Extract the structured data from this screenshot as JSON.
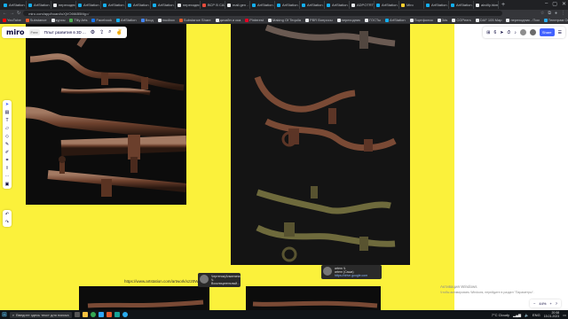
{
  "browser": {
    "tabs": [
      {
        "label": "ArtStation - Mari",
        "color": "#13aff0"
      },
      {
        "label": "ArtStation - Old",
        "color": "#13aff0"
      },
      {
        "label": "переходник",
        "color": "#e8eaed"
      },
      {
        "label": "ArtStation - Pipe",
        "color": "#13aff0"
      },
      {
        "label": "ArtStation - Old",
        "color": "#13aff0"
      },
      {
        "label": "ArtStation - Mari",
        "color": "#13aff0"
      },
      {
        "label": "ArtStation - Old",
        "color": "#13aff0"
      },
      {
        "label": "переходник - Пои",
        "color": "#e8eaed"
      },
      {
        "label": "ВСР В САРАТО",
        "color": "#e74c3c"
      },
      {
        "label": "mail.gen - Поис",
        "color": "#e8eaed"
      },
      {
        "label": "ArtStation - Sec",
        "color": "#13aff0"
      },
      {
        "label": "ArtStation - Virtu",
        "color": "#13aff0"
      },
      {
        "label": "ArtStation - Sec",
        "color": "#13aff0"
      },
      {
        "label": "ArtStation - Sec",
        "color": "#13aff0"
      },
      {
        "label": "ADPOTRT 6880",
        "color": "#e8eaed"
      },
      {
        "label": "ArtStation - Rus",
        "color": "#13aff0"
      },
      {
        "label": "Miro",
        "color": "#ffd02f"
      },
      {
        "label": "ArtStation - Sec",
        "color": "#13aff0"
      },
      {
        "label": "ArtStation - Gen",
        "color": "#13aff0"
      },
      {
        "label": "akvilly.hkm-mo",
        "color": "#e8eaed"
      }
    ],
    "address": "miro.com/app/board/uXjVO6fAB5Mg=/",
    "bookmarks": [
      {
        "label": "YouTube",
        "color": "#ff0000"
      },
      {
        "label": "Substance",
        "color": "#e55a2b"
      },
      {
        "label": "курсы",
        "color": "#e8eaed"
      },
      {
        "label": "Tilly Arts",
        "color": "#4caf50"
      },
      {
        "label": "Facebook",
        "color": "#1877f2"
      },
      {
        "label": "ArtStation",
        "color": "#13aff0"
      },
      {
        "label": "Вход",
        "color": "#4285f4"
      },
      {
        "label": "mudbox",
        "color": "#e8eaed"
      },
      {
        "label": "Substance Share",
        "color": "#e55a2b"
      },
      {
        "label": "дизайн и ска",
        "color": "#e8eaed"
      },
      {
        "label": "Pinterest",
        "color": "#e60023"
      },
      {
        "label": "Making Of Tequila",
        "color": "#e8eaed"
      },
      {
        "label": "PBR Вопросы",
        "color": "#e8eaed"
      },
      {
        "label": "переходник",
        "color": "#e8eaed"
      },
      {
        "label": "ГОСТы",
        "color": "#e8eaed"
      },
      {
        "label": "ArtStation",
        "color": "#13aff0"
      },
      {
        "label": "Портфолио",
        "color": "#e8eaed"
      },
      {
        "label": "3ds",
        "color": "#e8eaed"
      },
      {
        "label": "CGPeers",
        "color": "#e8eaed"
      },
      {
        "label": "DAF 105 Map",
        "color": "#e8eaed"
      },
      {
        "label": "переходник - Пои",
        "color": "#e8eaed"
      },
      {
        "label": "Телеграм Онлайн",
        "color": "#2aabee"
      }
    ]
  },
  "miro": {
    "logo": "miro",
    "plan": "Free",
    "board_title": "Плыт развития в 3D ...",
    "rightbar": {
      "count": "6",
      "share_label": "Share",
      "zoom": "44%"
    },
    "toolbar": [
      "cursor",
      "template",
      "text",
      "sticky",
      "shape",
      "pen",
      "comment",
      "frame",
      "upload",
      "more",
      "apps"
    ],
    "link_text": "https://www.artstation.com/artwork/xz20WNz",
    "comments": [
      {
        "name": "Чертенок(Анжелина Ч.",
        "text": "Восклицательный...",
        "link": ""
      },
      {
        "name": "artem Ч.",
        "text": "artem (Саша)",
        "link": "https://drive.google.com"
      }
    ]
  },
  "windows": {
    "activation_title": "Активация Windows",
    "activation_sub": "Чтобы активировать Windows, перейдите в раздел \"Параметры\".",
    "search_placeholder": "Введите здесь текст для поиска",
    "weather": "7°C Cloudy",
    "lang": "ENG",
    "time": "20:58",
    "date": "15.01.2023"
  },
  "colors": {
    "canvas_bg": "#fbf13b",
    "art_bg": "#0c0c0c",
    "miro_accent": "#4262ff"
  }
}
